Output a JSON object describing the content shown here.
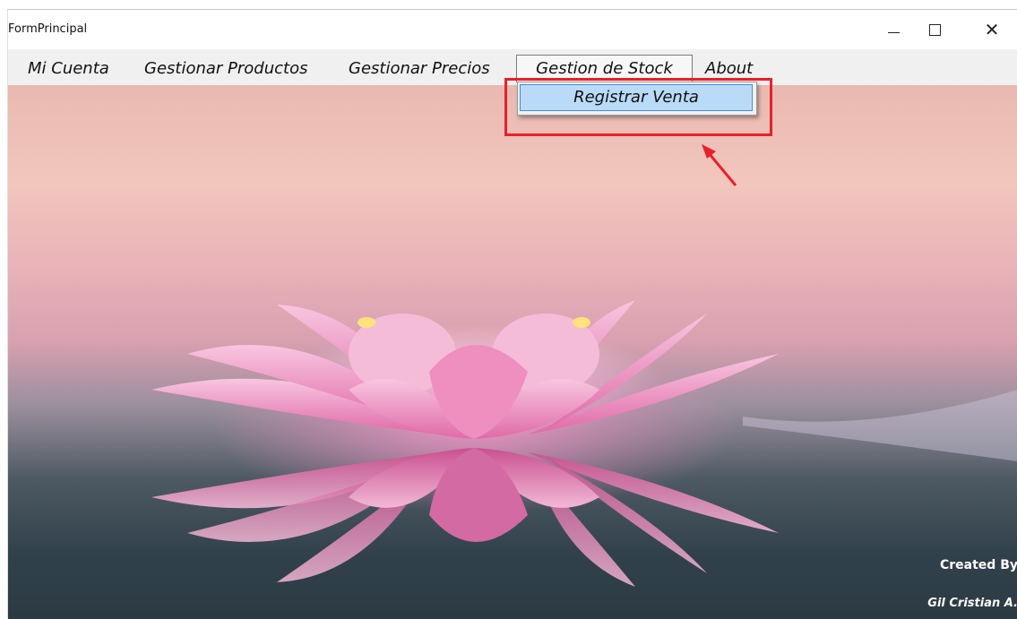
{
  "window": {
    "title": "FormPrincipal"
  },
  "menu": {
    "items": [
      {
        "label": "Mi Cuenta"
      },
      {
        "label": "Gestionar Productos"
      },
      {
        "label": "Gestionar Precios"
      },
      {
        "label": "Gestion de Stock"
      },
      {
        "label": "About"
      }
    ],
    "open_dropdown": {
      "items": [
        {
          "label": "Registrar Venta"
        }
      ]
    }
  },
  "credits": {
    "line1": "Created By",
    "line2": "Gil Cristian A."
  },
  "colors": {
    "highlight": "#e8202a",
    "menu_bg": "#f0f0f0",
    "selected_item": "#b9dbf7"
  },
  "icons": [
    "minimize-icon",
    "maximize-icon",
    "close-icon",
    "arrow-icon"
  ]
}
